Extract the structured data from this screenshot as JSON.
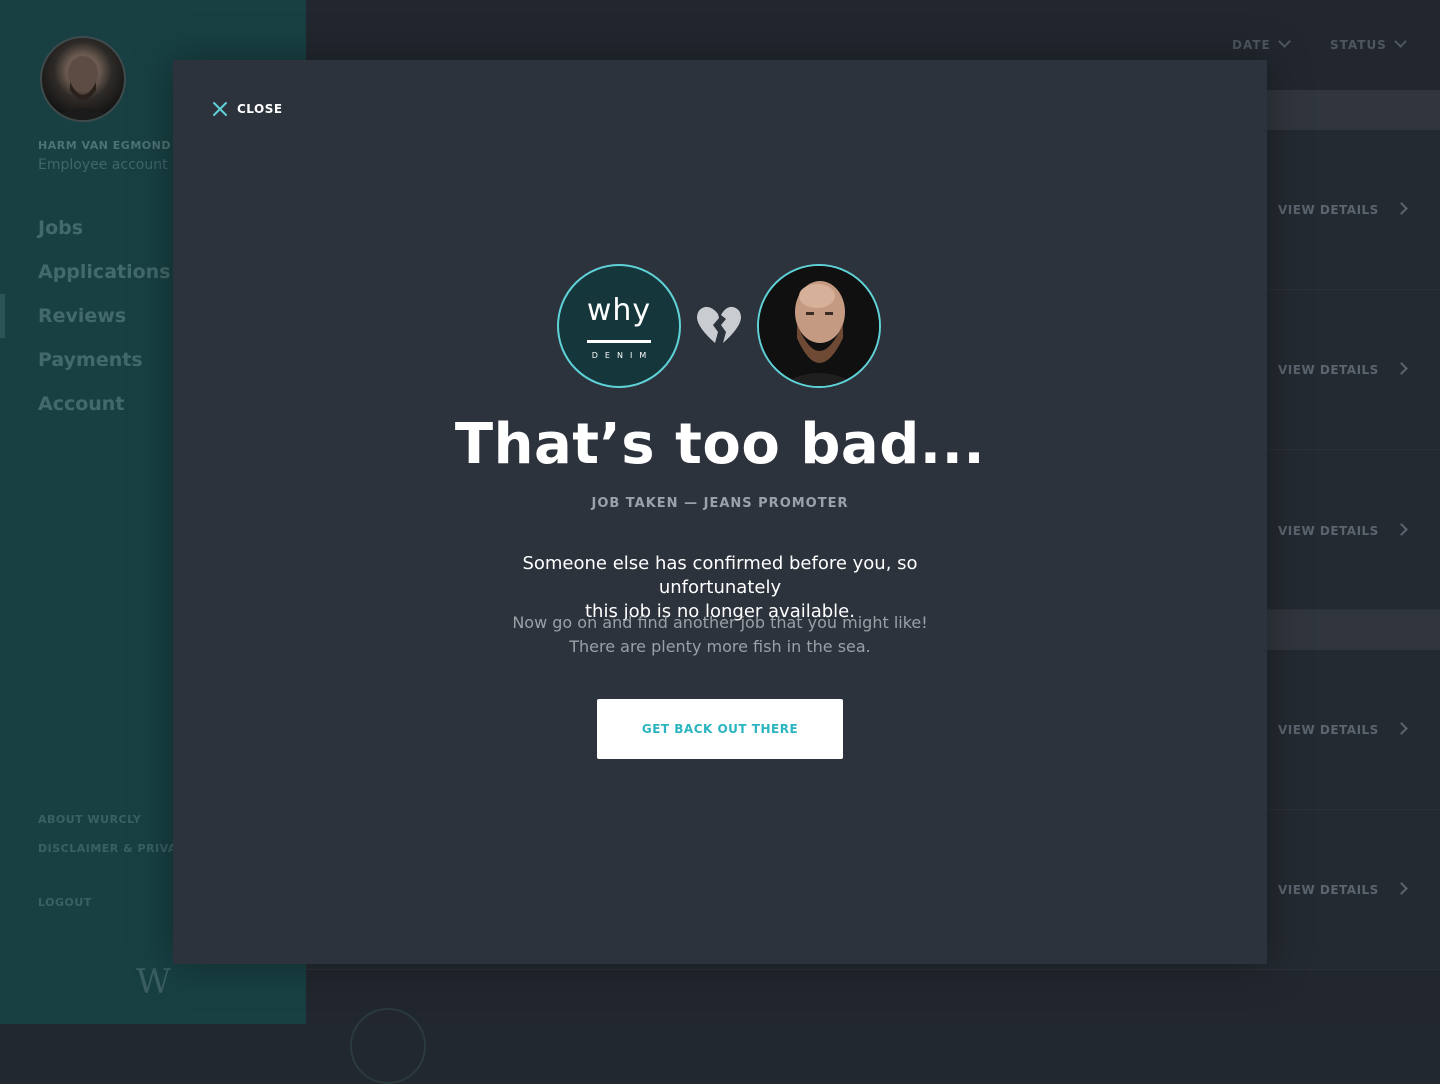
{
  "sidebar": {
    "user_name": "HARM VAN EGMOND",
    "user_role": "Employee account",
    "nav": [
      {
        "label": "Jobs",
        "active": false
      },
      {
        "label": "Applications",
        "active": false
      },
      {
        "label": "Reviews",
        "active": true
      },
      {
        "label": "Payments",
        "active": false
      },
      {
        "label": "Account",
        "active": false
      }
    ],
    "footer": {
      "about": "ABOUT WURCLY",
      "disclaimer": "DISCLAIMER & PRIVA",
      "logout": "LOGOUT"
    },
    "logo_letter": "W"
  },
  "main": {
    "filters": {
      "date": "DATE",
      "status": "STATUS"
    },
    "rows": [
      {
        "action": "VIEW DETAILS"
      },
      {
        "action": "VIEW DETAILS"
      },
      {
        "action": "VIEW DETAILS"
      },
      {
        "action": "VIEW DETAILS"
      },
      {
        "action": "VIEW DETAILS"
      }
    ]
  },
  "modal": {
    "close_label": "CLOSE",
    "brand": {
      "name": "why",
      "sub": "DENIM"
    },
    "title": "That’s too bad...",
    "subtitle": "JOB TAKEN — JEANS PROMOTER",
    "body_lines": [
      "Someone else has confirmed before you, so unfortunately",
      "this job is no longer available."
    ],
    "sub_lines": [
      "Now go on and find another job that you might like!",
      "There are plenty more fish in the sea."
    ],
    "cta_label": "GET BACK OUT THERE"
  },
  "colors": {
    "sidebar_bg": "#184043",
    "modal_bg": "#2d333c",
    "accent": "#5fd2d8",
    "cta_text": "#2bb5c0"
  },
  "icons": [
    "close-icon",
    "broken-heart-icon",
    "chevron-down-icon",
    "chevron-right-icon"
  ]
}
